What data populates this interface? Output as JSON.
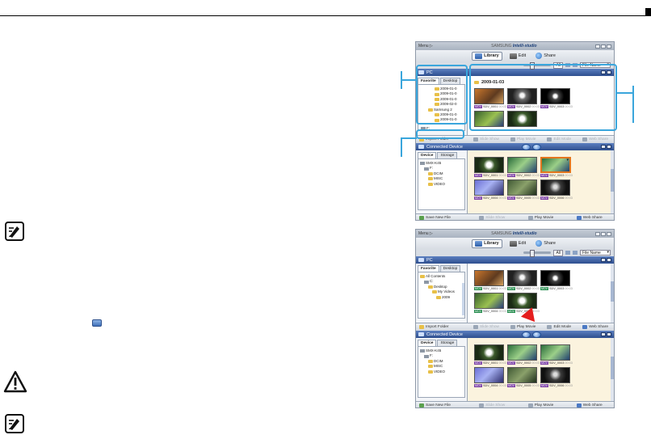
{
  "app": {
    "menu": "Menu ▷",
    "brand_prefix": "SAMSUNG",
    "brand_name": "Intelli-studio",
    "toolbar": {
      "library": "Library",
      "edit": "Edit",
      "share": "Share"
    },
    "filter_all": "All",
    "sort_select": "File Name",
    "pc_panel_title": "PC",
    "device_panel_title": "Connected Device",
    "tabs": {
      "favorite": "Favorite",
      "desktop": "Desktop",
      "device": "Device",
      "storage": "Storage"
    },
    "actions": {
      "import_folder": "Import Folder",
      "save_new_file": "Save New File",
      "slide_show": "Slide Show",
      "play_movie": "Play Movie",
      "edit_mode": "Edit Mode",
      "web_share": "Web Share"
    }
  },
  "window1": {
    "pc_tree": [
      "2009-01-0",
      "2009-01-0",
      "2009-01-0",
      "2009-02-0",
      "Samsung 2",
      "2009-01-0",
      "2009-01-0"
    ],
    "pc_tree_root": "F:",
    "date_header": "2009-01-03",
    "pc_thumbs": [
      {
        "name": "SDV_0001",
        "dur": "00:03"
      },
      {
        "name": "SDV_0002",
        "dur": "00:03"
      },
      {
        "name": "SDV_0003",
        "dur": "00:03"
      }
    ],
    "device_tree": [
      "SMX-K45",
      "F:",
      "DCIM",
      "MISC",
      "VIDEO"
    ],
    "device_thumbs": [
      {
        "name": "SDV_0001",
        "dur": "00:03"
      },
      {
        "name": "SDV_0002",
        "dur": "00:03"
      },
      {
        "name": "SDV_0003",
        "dur": "00:03"
      },
      {
        "name": "SDV_0004",
        "dur": "00:03"
      },
      {
        "name": "SDV_0005",
        "dur": "00:03"
      },
      {
        "name": "SDV_0006",
        "dur": "00:03"
      }
    ]
  },
  "window2": {
    "pc_tree": [
      "All Contents",
      "C:",
      "Desktop",
      "My Videos",
      "2009"
    ],
    "pc_thumbs": [
      {
        "name": "SDV_0001",
        "dur": "00:03"
      },
      {
        "name": "SDV_0002",
        "dur": "00:03"
      },
      {
        "name": "SDV_0003",
        "dur": "00:03"
      },
      {
        "name": "SDV_0004",
        "dur": "00:03"
      },
      {
        "name": "SDV_0005",
        "dur": "00:03"
      }
    ],
    "device_tree": [
      "SMX-K45",
      "F:",
      "DCIM",
      "MISC",
      "VIDEO"
    ],
    "device_thumbs": [
      {
        "name": "SDV_0001",
        "dur": "00:03"
      },
      {
        "name": "SDV_0002",
        "dur": "00:03"
      },
      {
        "name": "SDV_0003",
        "dur": "00:03"
      },
      {
        "name": "SDV_0004",
        "dur": "00:03"
      },
      {
        "name": "SDV_0005",
        "dur": "00:03"
      },
      {
        "name": "SDV_0006",
        "dur": "00:03"
      }
    ]
  }
}
